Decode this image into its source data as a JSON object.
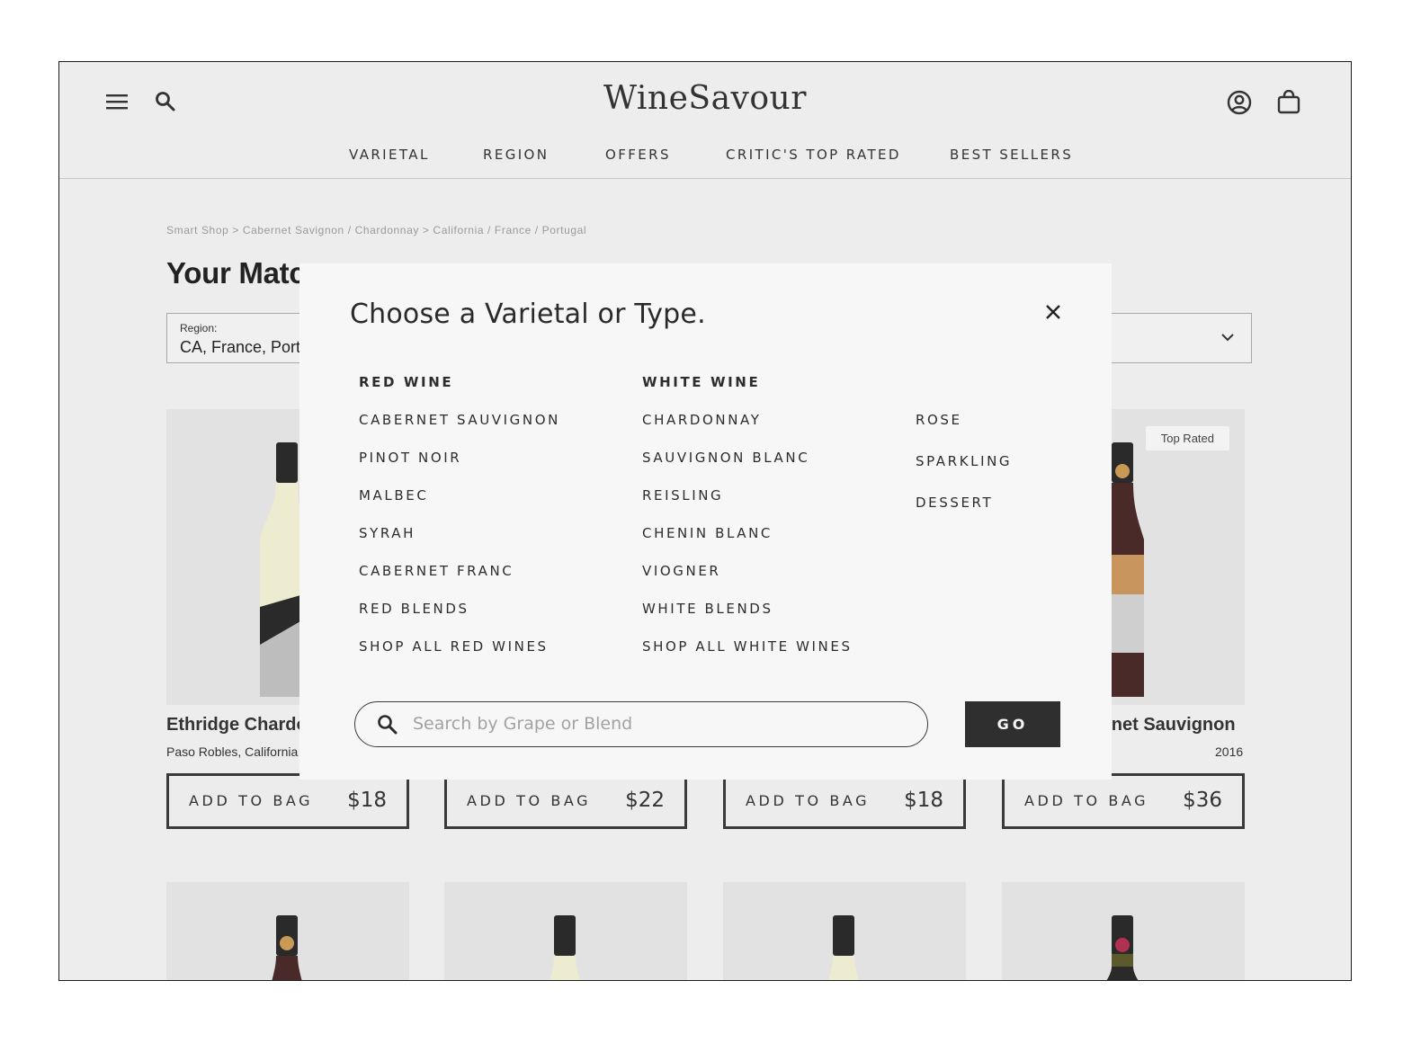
{
  "header": {
    "logo": "WineSavour",
    "nav": [
      "VARIETAL",
      "REGION",
      "OFFERS",
      "CRITIC'S TOP RATED",
      "BEST SELLERS"
    ]
  },
  "page": {
    "breadcrumb": "Smart Shop > Cabernet Savignon / Chardonnay > California / France / Portugal",
    "title": "Your Matc",
    "filter": {
      "label": "Region:",
      "value": "CA, France, Port"
    }
  },
  "products": [
    {
      "name": "Ethridge Chardo",
      "subtitle": "Paso Robles, California",
      "add_label": "ADD TO BAG",
      "price": "$18",
      "badge": ""
    },
    {
      "name": "",
      "subtitle": "",
      "add_label": "ADD TO BAG",
      "price": "$22",
      "badge": ""
    },
    {
      "name": "",
      "subtitle": "",
      "add_label": "ADD TO BAG",
      "price": "$18",
      "badge": ""
    },
    {
      "name": "rnet Sauvignon",
      "subtitle": "2016",
      "add_label": "ADD TO BAG",
      "price": "$36",
      "badge": "Top Rated"
    }
  ],
  "modal": {
    "title": "Choose a Varietal or Type.",
    "columns": [
      {
        "heading": "RED WINE",
        "items": [
          "CABERNET SAUVIGNON",
          "PINOT NOIR",
          "MALBEC",
          "SYRAH",
          "CABERNET FRANC",
          "RED BLENDS",
          "SHOP ALL RED WINES"
        ]
      },
      {
        "heading": "WHITE WINE",
        "items": [
          "CHARDONNAY",
          "SAUVIGNON BLANC",
          "REISLING",
          "CHENIN BLANC",
          "VIOGNER",
          "WHITE BLENDS",
          "SHOP ALL WHITE WINES"
        ]
      },
      {
        "heading": "",
        "items": [
          "ROSE",
          "SPARKLING",
          "DESSERT"
        ]
      }
    ],
    "search": {
      "placeholder": "Search by Grape or Blend",
      "value": ""
    },
    "go_label": "GO"
  },
  "colors": {
    "background": "#ededed",
    "modal": "#f7f7f7",
    "button_dark": "#2f2f2f",
    "text": "#2b2b2b"
  },
  "icons": [
    "menu-icon",
    "search-icon",
    "account-icon",
    "shopping-bag-icon",
    "chevron-down-icon",
    "close-icon"
  ]
}
